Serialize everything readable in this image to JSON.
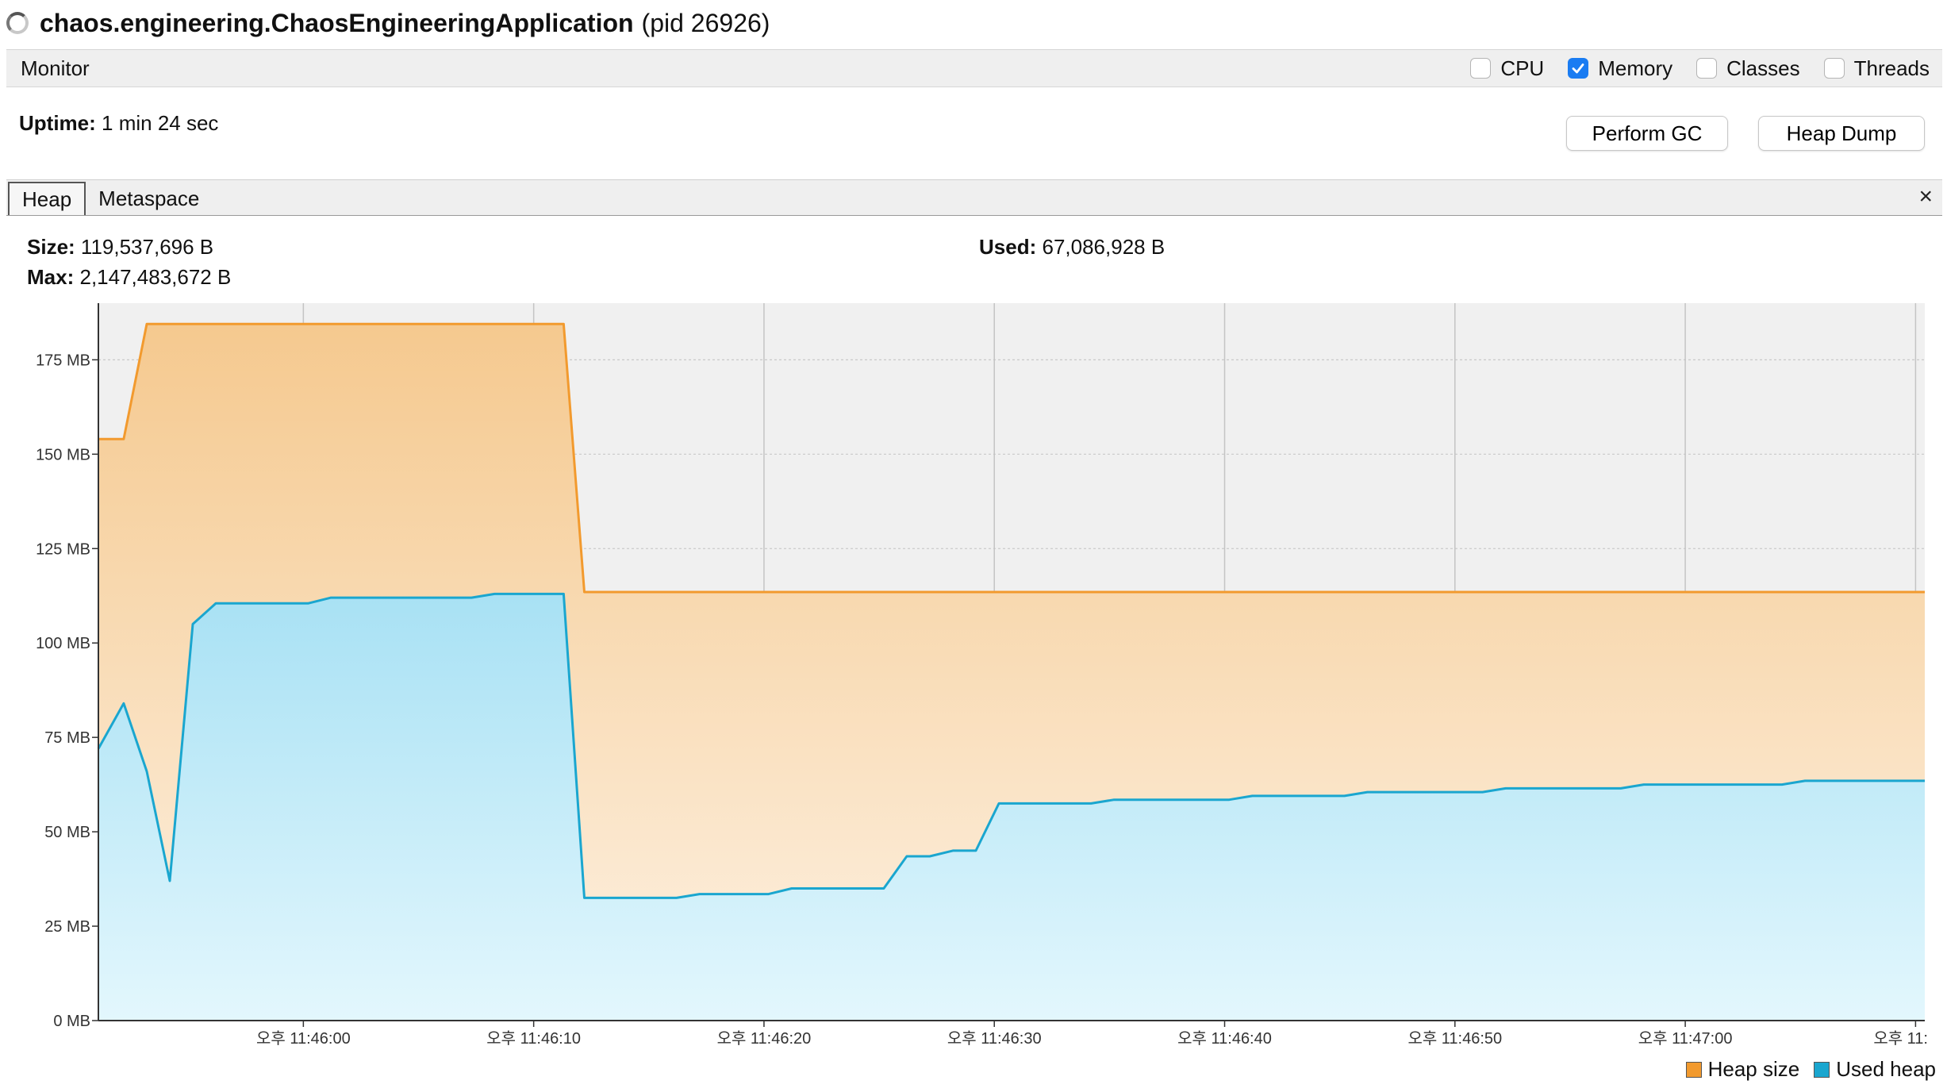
{
  "window": {
    "app_name": "chaos.engineering.ChaosEngineeringApplication",
    "pid_text": "(pid 26926)"
  },
  "monitor": {
    "title": "Monitor",
    "checkboxes": [
      {
        "label": "CPU",
        "checked": false
      },
      {
        "label": "Memory",
        "checked": true
      },
      {
        "label": "Classes",
        "checked": false
      },
      {
        "label": "Threads",
        "checked": false
      }
    ]
  },
  "uptime": {
    "label": "Uptime:",
    "value": "1 min 24 sec"
  },
  "buttons": {
    "perform_gc": "Perform GC",
    "heap_dump": "Heap Dump"
  },
  "tabs": [
    {
      "label": "Heap",
      "active": true
    },
    {
      "label": "Metaspace",
      "active": false
    }
  ],
  "close_glyph": "×",
  "stats": {
    "size": {
      "label": "Size:",
      "value": "119,537,696 B"
    },
    "max": {
      "label": "Max:",
      "value": "2,147,483,672 B"
    },
    "used": {
      "label": "Used:",
      "value": "67,086,928 B"
    }
  },
  "colors": {
    "heap_size": "#f29a2e",
    "used_heap": "#1aa6cf",
    "checkbox_on": "#1a7cf2"
  },
  "legend": [
    {
      "label": "Heap size",
      "color": "#f29a2e"
    },
    {
      "label": "Used heap",
      "color": "#1aa6cf"
    }
  ],
  "chart_data": {
    "type": "area",
    "y_unit": "MB",
    "ylim": [
      0,
      190
    ],
    "y_ticks": [
      "0 MB",
      "25 MB",
      "50 MB",
      "75 MB",
      "100 MB",
      "125 MB",
      "150 MB",
      "175 MB"
    ],
    "y_tick_values": [
      0,
      25,
      50,
      75,
      100,
      125,
      150,
      175
    ],
    "x_ticks": [
      "오후 11:46:00",
      "오후 11:46:10",
      "오후 11:46:20",
      "오후 11:46:30",
      "오후 11:46:40",
      "오후 11:46:50",
      "오후 11:47:00",
      "오후 11:"
    ],
    "x_tick_seconds": [
      0,
      10,
      20,
      30,
      40,
      50,
      60,
      70
    ],
    "xlim_seconds": [
      -8.9,
      70.4
    ],
    "grid": true,
    "legend_position": "bottom-right",
    "series": [
      {
        "name": "Heap size",
        "x_seconds": [
          -8.9,
          -7.8,
          -6.8,
          11.3,
          12.2,
          70.4
        ],
        "values": [
          154,
          154,
          184.5,
          184.5,
          113.5,
          113.5
        ]
      },
      {
        "name": "Used heap",
        "x_seconds": [
          -8.9,
          -7.8,
          -6.8,
          -5.8,
          -4.8,
          -3.8,
          -2.6,
          0.2,
          1.2,
          7.3,
          8.3,
          11.3,
          12.2,
          16.2,
          17.2,
          20.2,
          21.2,
          25.2,
          26.2,
          27.2,
          28.2,
          29.2,
          30.2,
          34.2,
          35.2,
          40.2,
          41.2,
          45.2,
          46.2,
          51.2,
          52.2,
          57.2,
          58.2,
          64.2,
          65.2,
          70.4
        ],
        "values": [
          72,
          84,
          66,
          37,
          105,
          110.5,
          110.5,
          110.5,
          112,
          112,
          113,
          113,
          32.5,
          32.5,
          33.5,
          33.5,
          35,
          35,
          43.5,
          43.5,
          45,
          45,
          57.5,
          57.5,
          58.5,
          58.5,
          59.5,
          59.5,
          60.5,
          60.5,
          61.5,
          61.5,
          62.5,
          62.5,
          63.5,
          63.5
        ]
      }
    ]
  }
}
